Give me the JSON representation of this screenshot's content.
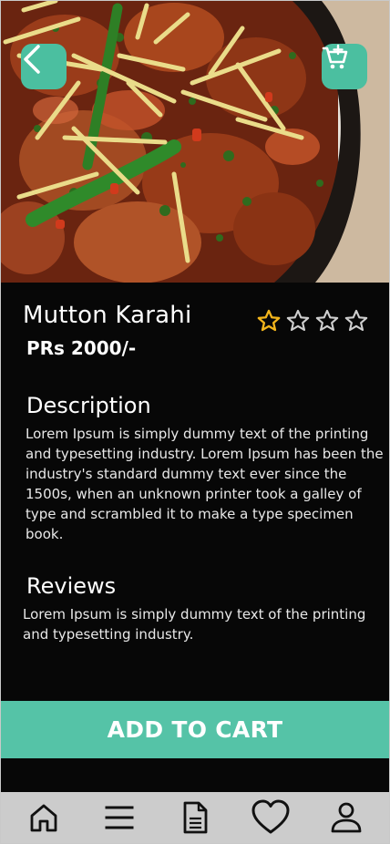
{
  "product": {
    "name": "Mutton Karahi",
    "price": "PRs 2000/-",
    "rating": 1,
    "rating_max": 4
  },
  "icons": {
    "back": "chevron-left-icon",
    "cart": "add-to-cart-icon",
    "star": "star-icon",
    "home": "home-icon",
    "menu": "menu-icon",
    "document": "document-icon",
    "favorite": "heart-icon",
    "profile": "user-icon"
  },
  "description": {
    "title": "Description",
    "text": "Lorem Ipsum is simply dummy text of the printing and typesetting industry. Lorem Ipsum has been the industry's standard dummy text ever since the 1500s, when an unknown printer took a galley of type and scrambled it to make a type specimen book."
  },
  "reviews": {
    "title": "Reviews",
    "text": "Lorem Ipsum is simply dummy text of the printing and typesetting industry."
  },
  "actions": {
    "add_to_cart_label": "ADD TO CART"
  },
  "colors": {
    "accent": "#55c3a7",
    "star_filled": "#f2b51c",
    "background": "#070707",
    "nav_background": "#cccccc"
  }
}
